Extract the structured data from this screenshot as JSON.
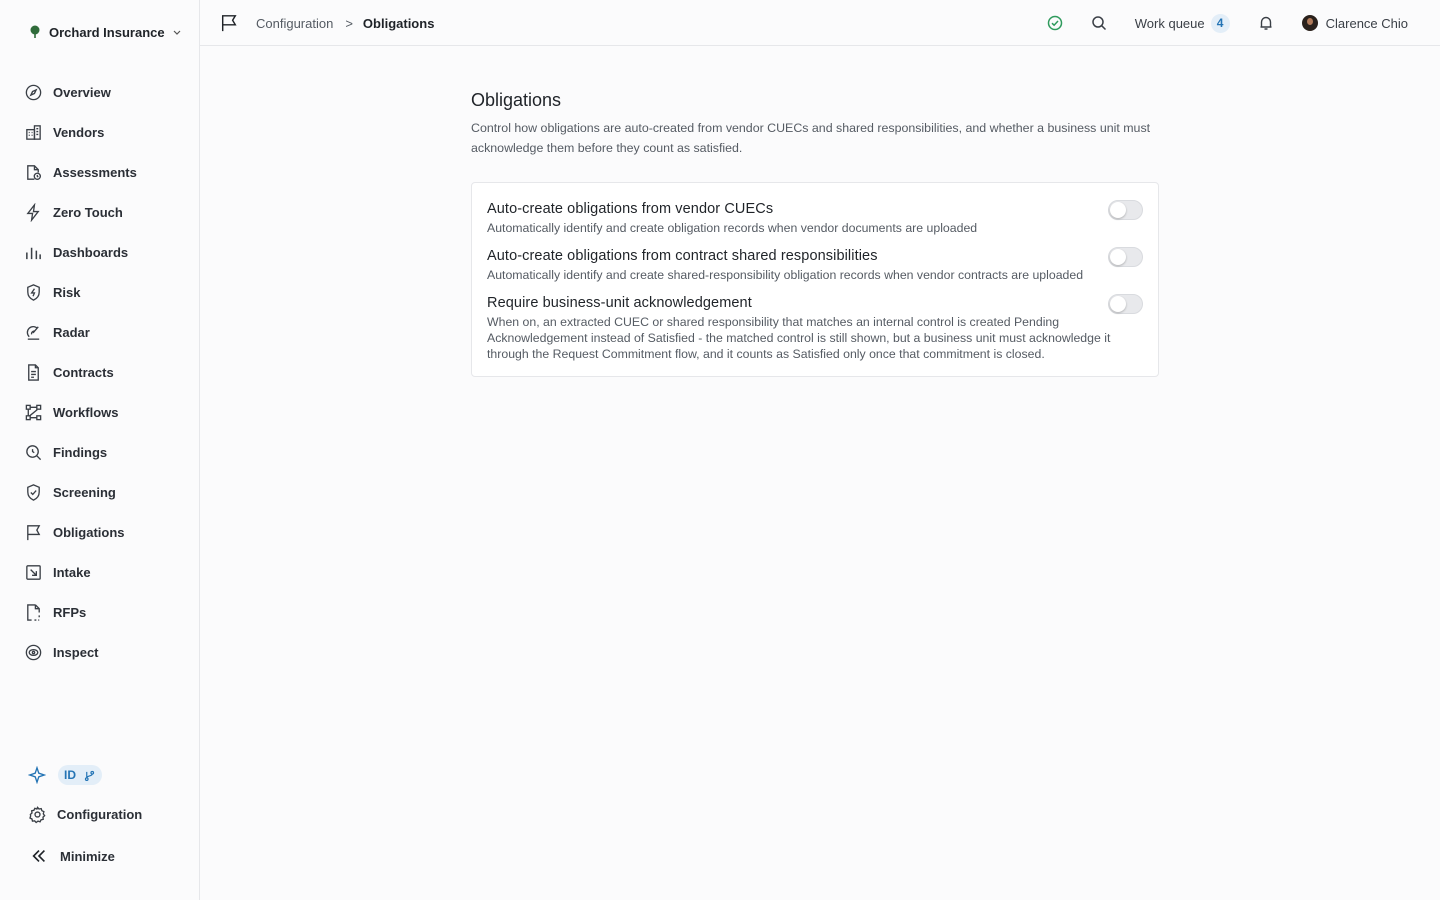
{
  "org": {
    "name": "Orchard Insurance"
  },
  "nav": [
    {
      "label": "Overview",
      "icon": "compass-icon"
    },
    {
      "label": "Vendors",
      "icon": "building-icon"
    },
    {
      "label": "Assessments",
      "icon": "document-clock-icon"
    },
    {
      "label": "Zero Touch",
      "icon": "lightning-icon"
    },
    {
      "label": "Dashboards",
      "icon": "bar-chart-icon"
    },
    {
      "label": "Risk",
      "icon": "shield-bolt-icon"
    },
    {
      "label": "Radar",
      "icon": "radar-icon"
    },
    {
      "label": "Contracts",
      "icon": "contract-icon"
    },
    {
      "label": "Workflows",
      "icon": "workflow-icon"
    },
    {
      "label": "Findings",
      "icon": "magnifier-clock-icon"
    },
    {
      "label": "Screening",
      "icon": "shield-check-icon"
    },
    {
      "label": "Obligations",
      "icon": "flag-icon"
    },
    {
      "label": "Intake",
      "icon": "intake-arrow-icon"
    },
    {
      "label": "RFPs",
      "icon": "document-dashed-icon"
    },
    {
      "label": "Inspect",
      "icon": "eye-icon"
    }
  ],
  "sidebar_bottom": {
    "badge_label": "ID",
    "configuration_label": "Configuration",
    "minimize_label": "Minimize"
  },
  "breadcrumb": {
    "parent": "Configuration",
    "separator": ">",
    "current": "Obligations"
  },
  "topbar": {
    "work_queue_label": "Work queue",
    "work_queue_count": "4",
    "user_name": "Clarence Chio"
  },
  "page": {
    "title": "Obligations",
    "description": "Control how obligations are auto-created from vendor CUECs and shared responsibilities, and whether a business unit must acknowledge them before they count as satisfied."
  },
  "settings": [
    {
      "title": "Auto-create obligations from vendor CUECs",
      "description": "Automatically identify and create obligation records when vendor documents are uploaded",
      "enabled": false
    },
    {
      "title": "Auto-create obligations from contract shared responsibilities",
      "description": "Automatically identify and create shared-responsibility obligation records when vendor contracts are uploaded",
      "enabled": false
    },
    {
      "title": "Require business-unit acknowledgement",
      "description": "When on, an extracted CUEC or shared responsibility that matches an internal control is created Pending Acknowledgement instead of Satisfied - the matched control is still shown, but a business unit must acknowledge it through the Request Commitment flow, and it counts as Satisfied only once that commitment is closed.",
      "enabled": false
    }
  ],
  "colors": {
    "accent": "#2474b5",
    "status_ok": "#2e9a5c",
    "org_logo": "#2f6b3a"
  }
}
